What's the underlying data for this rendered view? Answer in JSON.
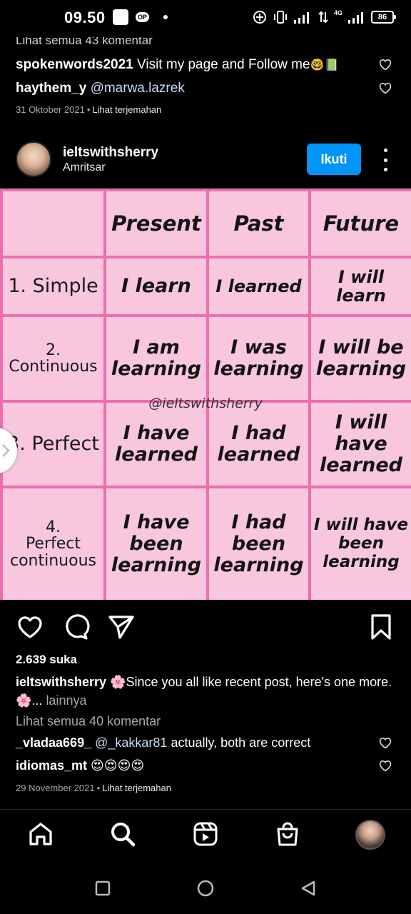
{
  "status_bar": {
    "time": "09.50",
    "badge": "OP",
    "network": "4G",
    "battery": "86"
  },
  "previous_post": {
    "cut_text": "Lihat semua 43 komentar",
    "comments": [
      {
        "user": "spokenwords2021",
        "text": "Visit my page and Follow me",
        "emoji": "🤓📗"
      },
      {
        "user": "haythem_y",
        "mention": "@marwa.lazrek"
      }
    ],
    "date": "31 Oktober 2021",
    "translate": "Lihat terjemahan"
  },
  "post": {
    "username": "ieltswithsherry",
    "location": "Amritsar",
    "follow_label": "Ikuti",
    "image": {
      "headers": [
        "",
        "Present",
        "Past",
        "Future"
      ],
      "rows": [
        {
          "label": "1. Simple",
          "cells": [
            "I learn",
            "I learned",
            "I will learn"
          ]
        },
        {
          "label": "2.\nContinuous",
          "cells": [
            "I am learning",
            "I was learning",
            "I will be learning"
          ]
        },
        {
          "label": "3. Perfect",
          "cells": [
            "I have learned",
            "I had learned",
            "I will have learned"
          ]
        },
        {
          "label": "4.\nPerfect continuous",
          "cells": [
            "I have been learning",
            "I had been learning",
            "I will have been learning"
          ]
        }
      ],
      "watermark": "@ieltswithsherry"
    },
    "likes": "2.639 suka",
    "caption_user": "ieltswithsherry",
    "caption_text": "🌸Since you all like recent post, here's one more. 🌸...",
    "caption_more": "lainnya",
    "view_all": "Lihat semua 40 komentar",
    "comments": [
      {
        "user": "_vladaa669_",
        "mention": "@_kakkar81",
        "text": "actually, both are correct"
      },
      {
        "user": "idiomas_mt",
        "text": "😍😍😍😍"
      }
    ],
    "date": "29 November 2021",
    "translate": "Lihat terjemahan"
  },
  "colors": {
    "accent": "#0095f6",
    "table_bg": "#f8c6dd",
    "table_border": "#ea6fb0"
  },
  "icons": [
    "heart-icon",
    "comment-icon",
    "share-icon",
    "bookmark-icon",
    "home-icon",
    "search-icon",
    "reels-icon",
    "shop-icon"
  ]
}
